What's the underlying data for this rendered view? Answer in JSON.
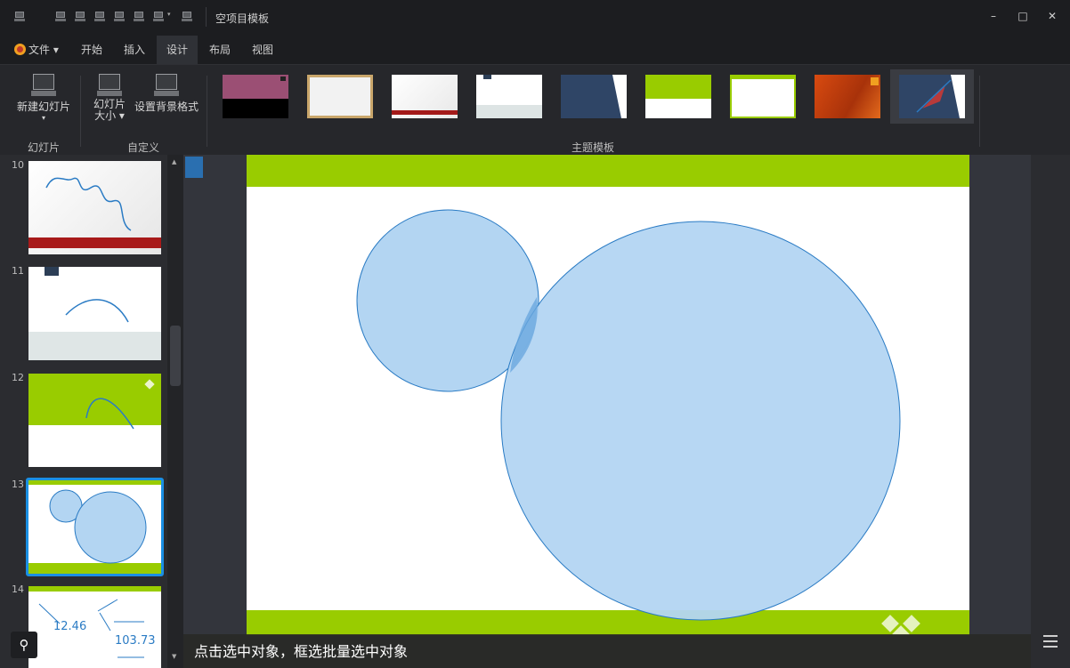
{
  "window": {
    "title": "空项目模板",
    "minimize": "–",
    "maximize": "□",
    "close": "✕"
  },
  "menu": {
    "file": "文件 ▾",
    "items": [
      "开始",
      "插入",
      "设计",
      "布局",
      "视图"
    ],
    "active": "设计"
  },
  "ribbon": {
    "new_slide": "新建幻灯片",
    "new_slide_arrow": "▾",
    "slide_size_line1": "幻灯片",
    "slide_size_line2": "大小 ▾",
    "bg_format": "设置背景格式",
    "group_slides": "幻灯片",
    "group_custom": "自定义",
    "group_themes": "主题模板"
  },
  "slides": {
    "numbers": [
      "10",
      "11",
      "12",
      "13",
      "14"
    ],
    "selected": "13",
    "thumb14_value1": "12.46",
    "thumb14_value2": "103.73"
  },
  "status": {
    "hint": "点击选中对象，框选批量选中对象"
  },
  "colors": {
    "accent_green": "#99cc00",
    "circle_fill": "#b3d5f2",
    "circle_stroke": "#2a7bc4",
    "selection_blue": "#1a8fe3"
  },
  "icons": {
    "pin": "pin-icon",
    "menu": "hamburger-menu-icon"
  }
}
